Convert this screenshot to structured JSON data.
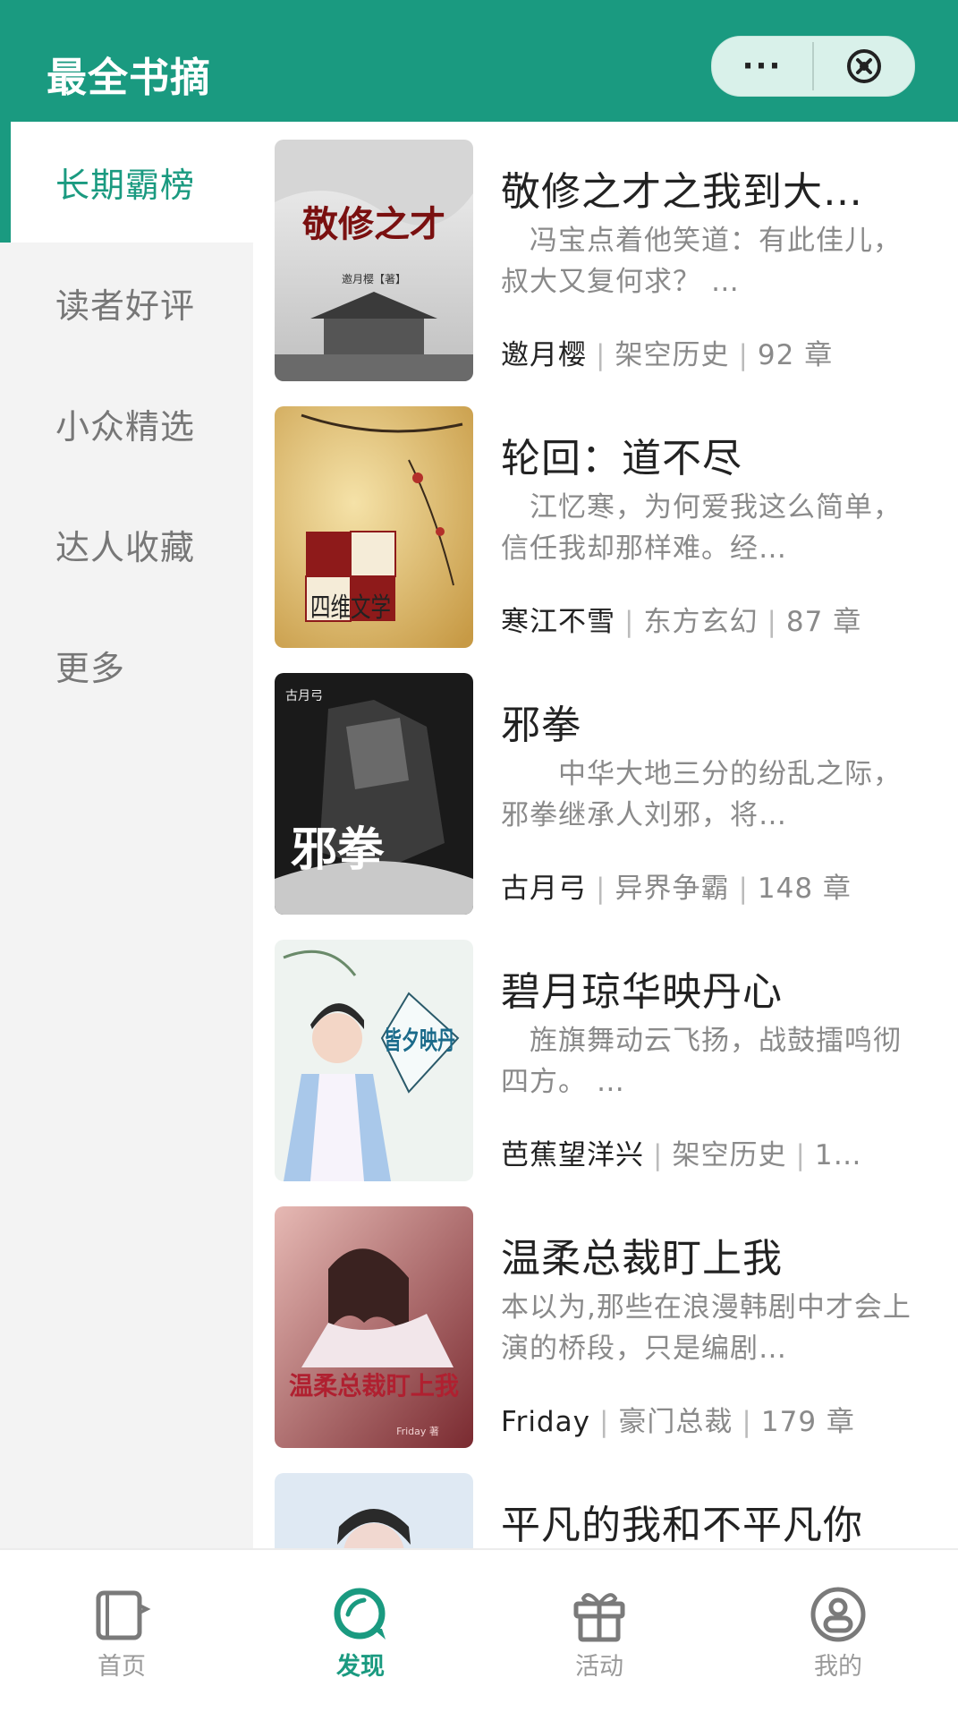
{
  "header": {
    "title": "最全书摘"
  },
  "colors": {
    "brand": "#1a9a80",
    "sidebar_bg": "#f3f3f3"
  },
  "capsule": {
    "more_label": "···",
    "close_icon": "close-circle-icon"
  },
  "sidebar": {
    "items": [
      {
        "label": "长期霸榜",
        "active": true
      },
      {
        "label": "读者好评",
        "active": false
      },
      {
        "label": "小众精选",
        "active": false
      },
      {
        "label": "达人收藏",
        "active": false
      },
      {
        "label": "更多",
        "active": false
      }
    ]
  },
  "books": [
    {
      "title": "敬修之才之我到大…",
      "desc": "　冯宝点着他笑道：有此佳儿，叔大又复何求？ …",
      "author": "邀月樱",
      "category": "架空历史",
      "chapters": "92 章",
      "cover_title": "敬修之才",
      "cover_author": "邀月樱【著】"
    },
    {
      "title": "轮回：道不尽",
      "desc": "　江忆寒，为何爱我这么简单，信任我却那样难。经…",
      "author": "寒江不雪",
      "category": "东方玄幻",
      "chapters": "87 章",
      "cover_title": "四维文学"
    },
    {
      "title": "邪拳",
      "desc": "　　中华大地三分的纷乱之际，邪拳继承人刘邪，将…",
      "author": "古月弓",
      "category": "异界争霸",
      "chapters": "148 章",
      "cover_title": "邪拳",
      "cover_author": "古月弓"
    },
    {
      "title": "碧月琼华映丹心",
      "desc": "　旌旗舞动云飞扬，战鼓擂鸣彻四方。 …",
      "author": "芭蕉望洋兴",
      "category": "架空历史",
      "chapters": "1…",
      "cover_title": "皆夕映丹"
    },
    {
      "title": "温柔总裁盯上我",
      "desc": "本以为,那些在浪漫韩剧中才会上演的桥段，只是编剧…",
      "author": "Friday",
      "category": "豪门总裁",
      "chapters": "179 章",
      "cover_title": "温柔总裁盯上我",
      "cover_author": "Friday 著"
    },
    {
      "title": "平凡的我和不平凡你"
    }
  ],
  "tabbar": {
    "items": [
      {
        "label": "首页",
        "icon": "book-icon",
        "active": false
      },
      {
        "label": "发现",
        "icon": "discover-icon",
        "active": true
      },
      {
        "label": "活动",
        "icon": "gift-icon",
        "active": false
      },
      {
        "label": "我的",
        "icon": "profile-icon",
        "active": false
      }
    ]
  }
}
